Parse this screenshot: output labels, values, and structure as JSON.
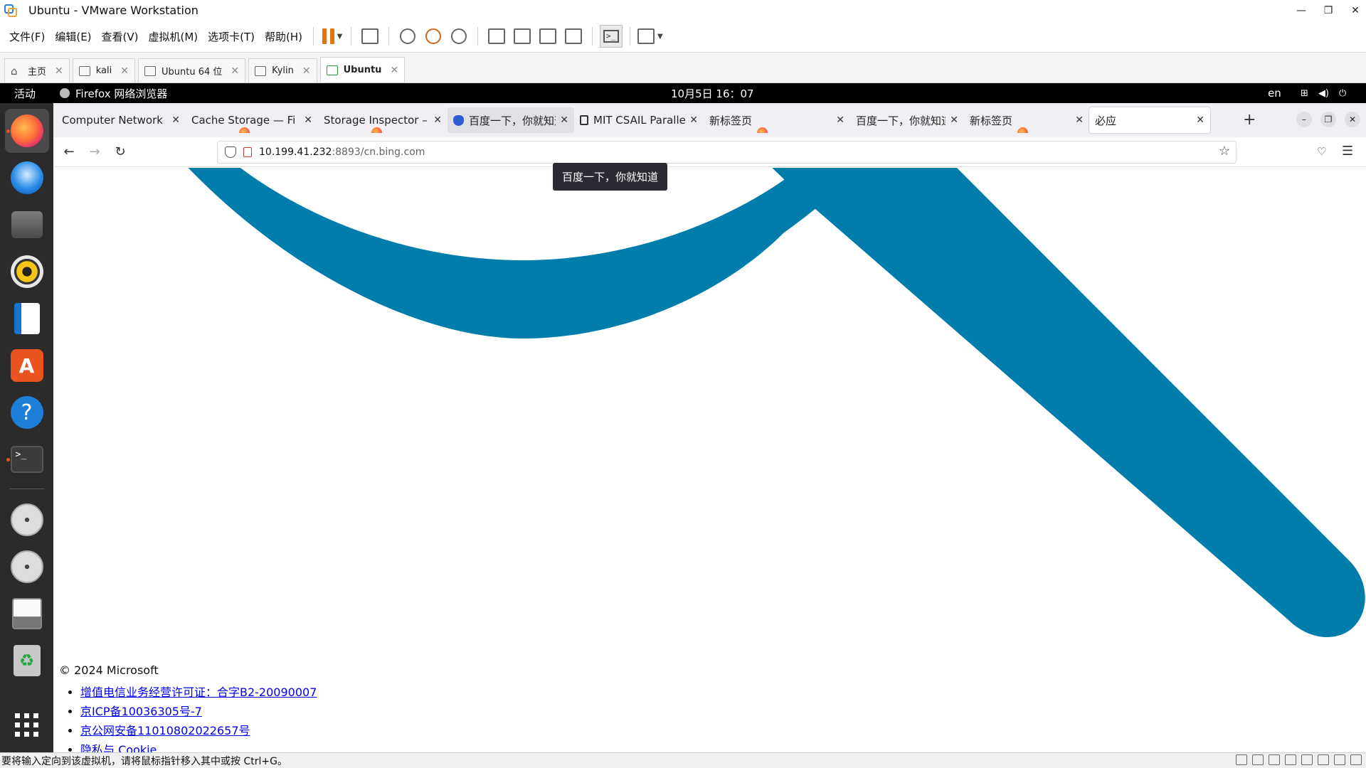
{
  "vmware": {
    "title": "Ubuntu - VMware Workstation",
    "window_controls": [
      "—",
      "❐",
      "✕"
    ],
    "menu": [
      "文件(F)",
      "编辑(E)",
      "查看(V)",
      "虚拟机(M)",
      "选项卡(T)",
      "帮助(H)"
    ],
    "tabs": [
      {
        "label": "主页",
        "active": false
      },
      {
        "label": "kali",
        "active": false
      },
      {
        "label": "Ubuntu 64 位",
        "active": false
      },
      {
        "label": "Kylin",
        "active": false
      },
      {
        "label": "Ubuntu",
        "active": true
      }
    ],
    "status_message": "要将输入定向到该虚拟机，请将鼠标指针移入其中或按 Ctrl+G。"
  },
  "gnome": {
    "activities": "活动",
    "app_indicator": "Firefox 网络浏览器",
    "clock": "10月5日  16：07",
    "lang": "en",
    "dock": [
      "firefox-icon",
      "thunderbird-icon",
      "files-icon",
      "rhythmbox-icon",
      "libreoffice-writer-icon",
      "app-store-icon",
      "help-icon",
      "terminal-icon",
      "disc-icon",
      "disc-icon",
      "floppy-icon",
      "trash-icon",
      "show-apps-icon"
    ]
  },
  "firefox": {
    "tabs": [
      {
        "label": "Computer Network Re",
        "fav": "none"
      },
      {
        "label": "Cache Storage — Fi",
        "fav": "ff"
      },
      {
        "label": "Storage Inspector –",
        "fav": "ff"
      },
      {
        "label": "百度一下，你就知道",
        "fav": "baidu"
      },
      {
        "label": "MIT CSAIL Parallel a",
        "fav": "mit"
      },
      {
        "label": "新标签页",
        "fav": "ff"
      },
      {
        "label": "百度一下，你就知道",
        "fav": "none"
      },
      {
        "label": "新标签页",
        "fav": "ff"
      },
      {
        "label": "必应",
        "fav": "none"
      }
    ],
    "url_host": "10.199.41.232",
    "url_rest": ":8893/cn.bing.com",
    "tooltip": "百度一下，你就知道",
    "page": {
      "copyright": "© 2024 Microsoft",
      "links": [
        "增值电信业务经营许可证：合字B2-20090007",
        "京ICP备10036305号-7",
        "京公网安备11010802022657号",
        "隐私与 Cookie"
      ],
      "logo_color": "#007daa"
    }
  }
}
